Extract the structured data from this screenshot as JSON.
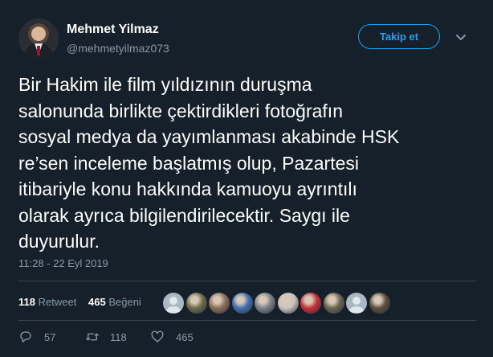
{
  "user": {
    "name": "Mehmet Yilmaz",
    "handle": "@mehmetyilmaz073",
    "avatar": "profile-photo"
  },
  "follow_button": {
    "label": "Takip et",
    "color": "#1da1f2"
  },
  "menu_icon": "chevron-down-icon",
  "tweet": {
    "lines": [
      "Bir Hakim ile film yıldızının duruşma",
      "salonunda birlikte çektirdikleri fotoğrafın",
      "sosyal medya da yayımlanması akabinde HSK",
      "re’sen inceleme başlatmış olup, Pazartesi",
      "itibariyle konu hakkında kamuoyu ayrıntılı",
      "olarak ayrıca bilgilendirilecektir. Saygı ile",
      "duyurulur."
    ],
    "timestamp": "11:28 - 22 Eyl 2019"
  },
  "stats": {
    "retweets_count": "118",
    "retweets_label": "Retweet",
    "likes_count": "465",
    "likes_label": "Beğeni"
  },
  "liker_avatars": [
    {
      "icon": "default-avatar",
      "color": "#aab8c2"
    },
    {
      "icon": "military-avatar",
      "color": "#6b6a4a"
    },
    {
      "icon": "person-avatar",
      "color": "#8b6e5a"
    },
    {
      "icon": "stadium-avatar",
      "color": "#3f6fb0"
    },
    {
      "icon": "crowd-avatar",
      "color": "#7a8088"
    },
    {
      "icon": "flower-avatar",
      "color": "#c9c2bd"
    },
    {
      "icon": "flag-avatar",
      "color": "#c8303a"
    },
    {
      "icon": "soldiers-avatar",
      "color": "#6a6550"
    },
    {
      "icon": "default-avatar",
      "color": "#aab8c2"
    },
    {
      "icon": "person-avatar",
      "color": "#5c4e3e"
    }
  ],
  "actions": {
    "reply_count": "57",
    "retweet_count": "118",
    "like_count": "465"
  },
  "colors": {
    "background": "#15202b",
    "secondary_text": "#8899a6",
    "divider": "#38444d",
    "accent": "#1da1f2"
  }
}
